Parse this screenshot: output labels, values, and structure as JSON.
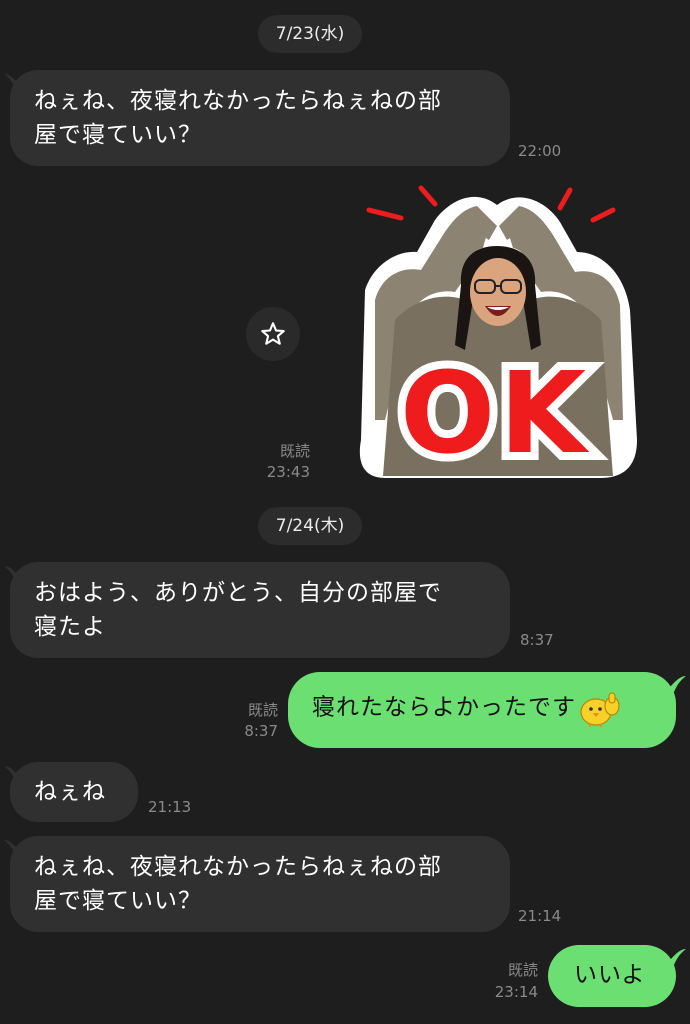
{
  "dates": [
    "7/23(水)",
    "7/24(木)"
  ],
  "messages": {
    "m1": {
      "line1": "ねぇね、夜寝れなかったらねぇねの部",
      "line2": "屋で寝ていい？",
      "time": "22:00"
    },
    "sticker": {
      "read": "既読",
      "time": "23:43",
      "text": "OK"
    },
    "m2": {
      "line1": "おはよう、ありがとう、自分の部屋で",
      "line2": "寝たよ",
      "time": "8:37"
    },
    "m3": {
      "text": "寝れたならよかったです",
      "read": "既読",
      "time": "8:37",
      "emoji": "chick-thumbs-up-emoji"
    },
    "m4": {
      "text": "ねぇね",
      "time": "21:13"
    },
    "m5": {
      "line1": "ねぇね、夜寝れなかったらねぇねの部",
      "line2": "屋で寝ていい？",
      "time": "21:14"
    },
    "m6": {
      "text": "いいよ",
      "read": "既読",
      "time": "23:14"
    }
  },
  "icons": {
    "star": "star-icon"
  },
  "colors": {
    "background": "#1e1e1e",
    "incoming": "#303030",
    "outgoing": "#6cdf73",
    "sticker_red": "#ee1c1c"
  }
}
